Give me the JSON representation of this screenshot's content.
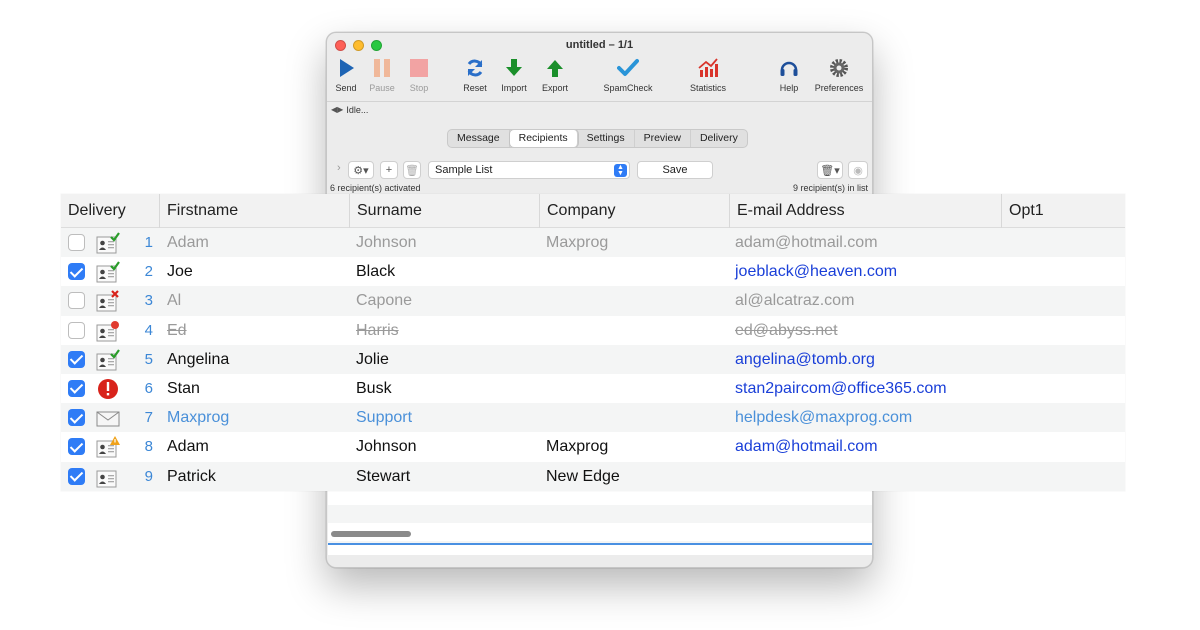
{
  "window": {
    "title": "untitled – 1/1",
    "status": "Idle...",
    "toolbar": [
      {
        "id": "send",
        "label": "Send",
        "icon": "play-icon",
        "enabled": true
      },
      {
        "id": "pause",
        "label": "Pause",
        "icon": "pause-icon",
        "enabled": false
      },
      {
        "id": "stop",
        "label": "Stop",
        "icon": "stop-icon",
        "enabled": false
      },
      {
        "id": "reset",
        "label": "Reset",
        "icon": "refresh-icon",
        "enabled": true
      },
      {
        "id": "import",
        "label": "Import",
        "icon": "arrow-down-icon",
        "enabled": true
      },
      {
        "id": "export",
        "label": "Export",
        "icon": "arrow-up-icon",
        "enabled": true
      },
      {
        "id": "spamcheck",
        "label": "SpamCheck",
        "icon": "checkmark-icon",
        "enabled": true
      },
      {
        "id": "statistics",
        "label": "Statistics",
        "icon": "chart-icon",
        "enabled": true
      },
      {
        "id": "help",
        "label": "Help",
        "icon": "headset-icon",
        "enabled": true
      },
      {
        "id": "preferences",
        "label": "Preferences",
        "icon": "gear-icon",
        "enabled": true
      }
    ],
    "tabs": [
      {
        "label": "Message",
        "active": false
      },
      {
        "label": "Recipients",
        "active": true
      },
      {
        "label": "Settings",
        "active": false
      },
      {
        "label": "Preview",
        "active": false
      },
      {
        "label": "Delivery",
        "active": false
      }
    ],
    "list_select": "Sample List",
    "save_label": "Save",
    "activated_count": "6 recipient(s) activated",
    "list_count": "9 recipient(s) in list"
  },
  "table": {
    "columns": [
      "Delivery",
      "Firstname",
      "Surname",
      "Company",
      "E-mail Address",
      "Opt1"
    ],
    "rows": [
      {
        "num": "1",
        "checked": false,
        "status": "valid",
        "style": "dim",
        "firstname": "Adam",
        "surname": "Johnson",
        "company": "Maxprog",
        "email": "adam@hotmail.com"
      },
      {
        "num": "2",
        "checked": true,
        "status": "valid",
        "style": "active",
        "firstname": "Joe",
        "surname": "Black",
        "company": "",
        "email": "joeblack@heaven.com"
      },
      {
        "num": "3",
        "checked": false,
        "status": "invalid",
        "style": "dim",
        "firstname": "Al",
        "surname": "Capone",
        "company": "",
        "email": "al@alcatraz.com"
      },
      {
        "num": "4",
        "checked": false,
        "status": "unsubscribed",
        "style": "strike",
        "firstname": "Ed",
        "surname": "Harris",
        "company": "",
        "email": "ed@abyss.net"
      },
      {
        "num": "5",
        "checked": true,
        "status": "valid",
        "style": "active",
        "firstname": "Angelina",
        "surname": "Jolie",
        "company": "",
        "email": "angelina@tomb.org"
      },
      {
        "num": "6",
        "checked": true,
        "status": "error",
        "style": "active",
        "firstname": "Stan",
        "surname": "Busk",
        "company": "",
        "email": "stan2paircom@office365.com"
      },
      {
        "num": "7",
        "checked": true,
        "status": "envelope",
        "style": "support",
        "firstname": "Maxprog",
        "surname": "Support",
        "company": "",
        "email": "helpdesk@maxprog.com"
      },
      {
        "num": "8",
        "checked": true,
        "status": "warning",
        "style": "active",
        "firstname": "Adam",
        "surname": "Johnson",
        "company": "Maxprog",
        "email": "adam@hotmail.com"
      },
      {
        "num": "9",
        "checked": true,
        "status": "plain",
        "style": "active",
        "firstname": "Patrick",
        "surname": "Stewart",
        "company": "New Edge",
        "email": ""
      }
    ]
  }
}
